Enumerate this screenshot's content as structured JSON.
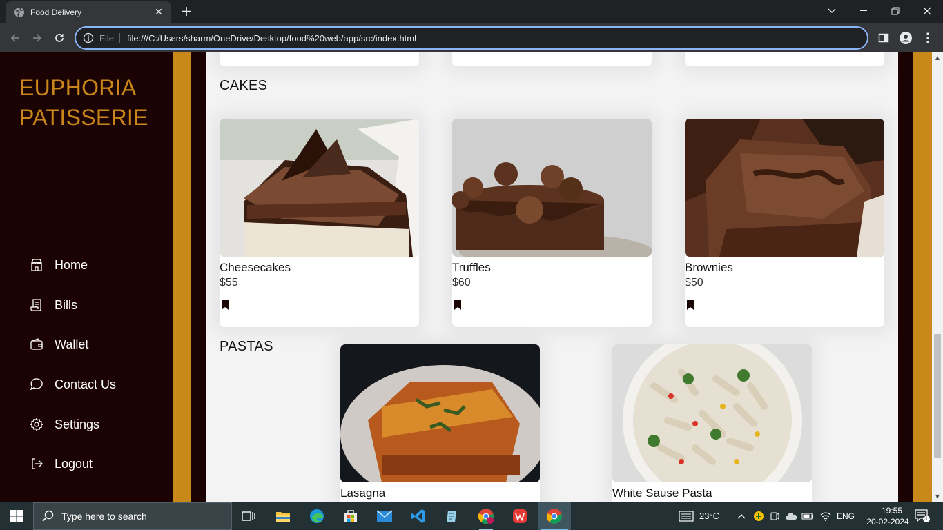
{
  "browser": {
    "tab_title": "Food Delivery",
    "url_scheme": "File",
    "url": "file:///C:/Users/sharm/OneDrive/Desktop/food%20web/app/src/index.html"
  },
  "sidebar": {
    "brand_line1": "EUPHORIA",
    "brand_line2": "PATISSERIE",
    "items": [
      {
        "label": "Home",
        "icon": "home-icon"
      },
      {
        "label": "Bills",
        "icon": "receipt-icon"
      },
      {
        "label": "Wallet",
        "icon": "wallet-icon"
      },
      {
        "label": "Contact Us",
        "icon": "chat-icon"
      },
      {
        "label": "Settings",
        "icon": "gear-icon"
      },
      {
        "label": "Logout",
        "icon": "logout-icon"
      }
    ]
  },
  "sections": {
    "cakes": {
      "title": "CAKES",
      "items": [
        {
          "name": "Cheesecakes",
          "price": "$55"
        },
        {
          "name": "Truffles",
          "price": "$60"
        },
        {
          "name": "Brownies",
          "price": "$50"
        }
      ]
    },
    "pastas": {
      "title": "PASTAS",
      "items": [
        {
          "name": "Lasagna"
        },
        {
          "name": "White Sause Pasta"
        }
      ]
    }
  },
  "taskbar": {
    "search_placeholder": "Type here to search",
    "weather": "23°C",
    "language": "ENG",
    "time": "19:55",
    "date": "20-02-2024",
    "notifications": "3"
  },
  "colors": {
    "sidebar_bg": "#1c0303",
    "accent_gold": "#c9881a",
    "content_bg": "#f3f3f4"
  }
}
